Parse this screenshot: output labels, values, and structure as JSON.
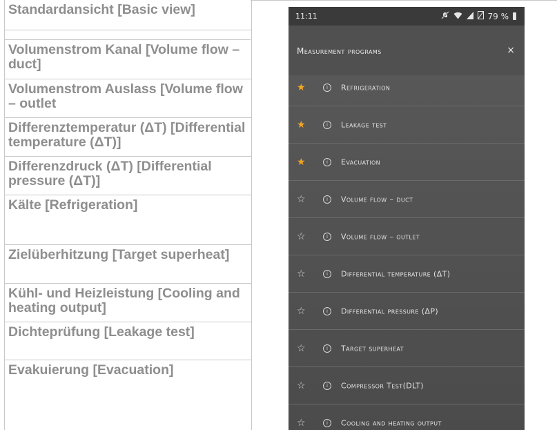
{
  "left_table": {
    "rows": [
      "Standardansicht [Basic view]",
      "Volumenstrom Kanal [Volume flow – duct]",
      "Volumenstrom Auslass [Volume flow – outlet",
      "Differenztemperatur (ΔT) [Differential temperature (ΔT)]",
      "Differenzdruck (ΔT) [Differential pressure (ΔT)]",
      "Kälte [Refrigeration]",
      "Zielüberhitzung [Target superheat]",
      "Kühl- und Heizleistung [Cooling and heating output]",
      "Dichteprüfung [Leakage test]",
      "Evakuierung [Evacuation]"
    ]
  },
  "phone": {
    "status_bar": {
      "time": "11:11",
      "battery_percent": "79 %",
      "icons": [
        "mute-icon",
        "wifi-icon",
        "signal-icon",
        "no-sim-icon",
        "battery-icon"
      ]
    },
    "header": {
      "title": "Measurement programs",
      "close_symbol": "×"
    },
    "programs": [
      {
        "label": "Refrigeration",
        "favorite": true
      },
      {
        "label": "Leakage test",
        "favorite": true
      },
      {
        "label": "Evacuation",
        "favorite": true
      },
      {
        "label": "Volume flow – duct",
        "favorite": false
      },
      {
        "label": "Volume flow – outlet",
        "favorite": false
      },
      {
        "label": "Differential temperature (ΔT)",
        "favorite": false
      },
      {
        "label": "Differential pressure (ΔP)",
        "favorite": false
      },
      {
        "label": "Target superheat",
        "favorite": false
      },
      {
        "label": "Compressor Test(DLT)",
        "favorite": false
      },
      {
        "label": "Cooling and heating output",
        "favorite": false
      }
    ],
    "colors": {
      "favorite_star": "#f5a623",
      "background": "#555555"
    }
  }
}
